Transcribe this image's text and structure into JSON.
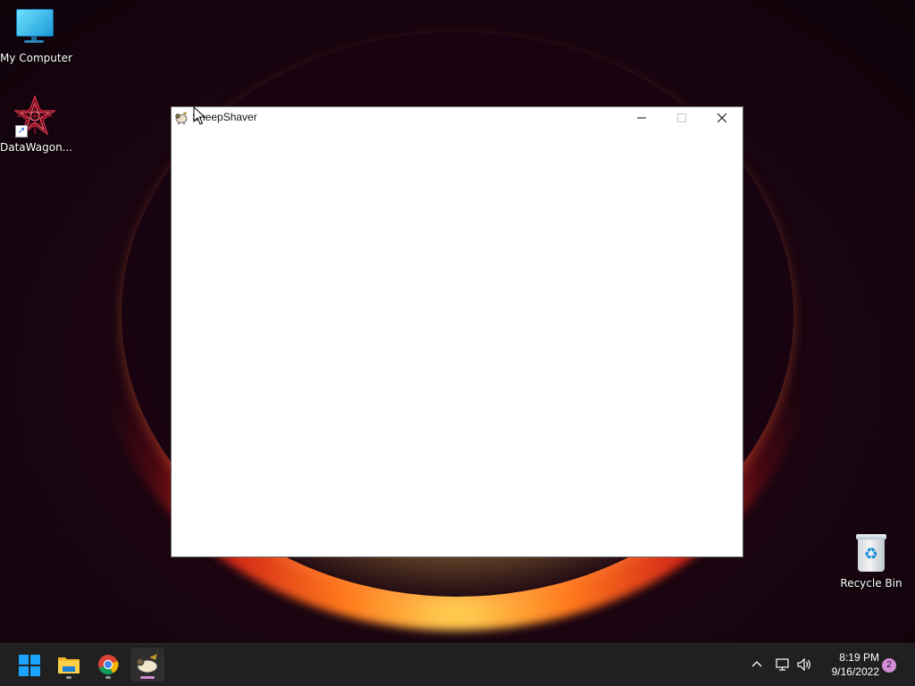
{
  "desktop": {
    "icons": [
      {
        "label": "My Computer",
        "icon": "computer-monitor-icon"
      },
      {
        "label": "DataWagon...",
        "icon": "datawagon-star-logo-icon",
        "shortcut": true
      },
      {
        "label": "Recycle Bin",
        "icon": "recycle-bin-icon"
      }
    ]
  },
  "window": {
    "title": "SheepShaver",
    "icon": "sheepshaver-icon",
    "controls": {
      "minimize": "minimize-icon",
      "maximize": "maximize-icon",
      "close": "close-icon"
    }
  },
  "taskbar": {
    "apps": [
      {
        "name": "start",
        "icon": "windows-logo-icon"
      },
      {
        "name": "file-explorer",
        "icon": "folder-icon",
        "running": true
      },
      {
        "name": "chrome",
        "icon": "chrome-icon",
        "running": true
      },
      {
        "name": "sheepshaver",
        "icon": "sheepshaver-icon",
        "running": true,
        "active": true
      }
    ],
    "tray": {
      "show_hidden_icon": "chevron-up-icon",
      "network_icon": "network-icon",
      "volume_icon": "volume-icon",
      "time": "8:19 PM",
      "date": "9/16/2022",
      "notifications": "2"
    }
  },
  "colors": {
    "taskbar_bg": "#202020",
    "notification_badge": "#d38bd6",
    "active_indicator": "#d38bd6"
  }
}
